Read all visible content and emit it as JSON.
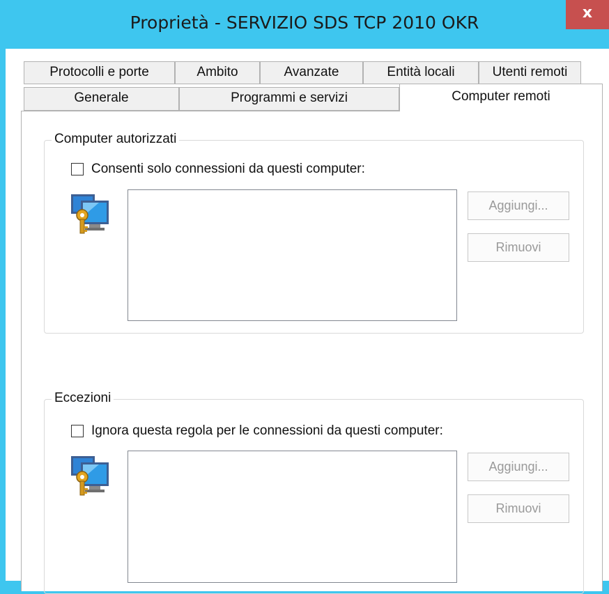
{
  "window": {
    "title": "Proprietà - SERVIZIO SDS TCP 2010 OKR",
    "close_glyph": "x"
  },
  "tabs": {
    "row1": [
      "Protocolli e porte",
      "Ambito",
      "Avanzate",
      "Entità locali",
      "Utenti remoti"
    ],
    "row2": [
      "Generale",
      "Programmi e servizi",
      "Computer remoti"
    ],
    "active": "Computer remoti"
  },
  "authorized": {
    "group_label": "Computer autorizzati",
    "checkbox_label": "Consenti solo connessioni da questi computer:",
    "checkbox_checked": false,
    "list_items": [],
    "add_label": "Aggiungi...",
    "remove_label": "Rimuovi",
    "icon": "remote-computer-key-icon"
  },
  "exceptions": {
    "group_label": "Eccezioni",
    "checkbox_label": "Ignora questa regola per le connessioni da questi computer:",
    "checkbox_checked": false,
    "list_items": [],
    "add_label": "Aggiungi...",
    "remove_label": "Rimuovi",
    "icon": "remote-computer-key-icon"
  },
  "colors": {
    "titlebar": "#3ec6ef",
    "close_button": "#c7504f",
    "tab_inactive": "#f0f0f0",
    "disabled_text": "#9a9a9a"
  }
}
